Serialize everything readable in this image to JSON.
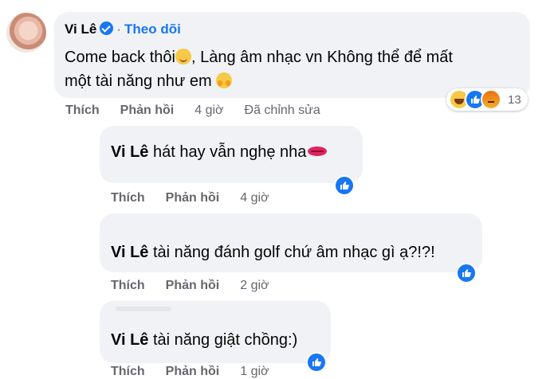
{
  "comment": {
    "author": "Vi Lê",
    "follow_label": "Theo dõi",
    "separator": "·",
    "text_line1": "Come back thôi",
    "text_line1_after": ", Làng âm nhạc vn Không thể để mất",
    "text_line2": "một tài năng như em",
    "like_label": "Thích",
    "reply_label": "Phản hồi",
    "time": "4 giờ",
    "edited_label": "Đã chỉnh sửa",
    "reaction_count": "13"
  },
  "replies": [
    {
      "author": "Vi Lê",
      "text": "hát hay vẫn nghẹ nha",
      "like_label": "Thích",
      "reply_label": "Phản hồi",
      "time": "4 giờ"
    },
    {
      "author": "Vi Lê",
      "text": "tài năng đánh golf chứ âm nhạc gì ạ?!?!",
      "like_label": "Thích",
      "reply_label": "Phản hồi",
      "time": "2 giờ"
    },
    {
      "author": "Vi Lê",
      "text": "tài năng giật chồng:)",
      "like_label": "Thích",
      "reply_label": "Phản hồi",
      "time": "1 giờ"
    }
  ],
  "colors": {
    "accent": "#1877f2",
    "bubble": "#f0f2f5",
    "muted": "#65676b"
  },
  "icons": [
    "avatar",
    "verified-badge-icon",
    "smile-emoji-icon",
    "hug-emoji-icon",
    "kiss-emoji-icon",
    "like-icon",
    "haha-icon",
    "angry-icon"
  ]
}
